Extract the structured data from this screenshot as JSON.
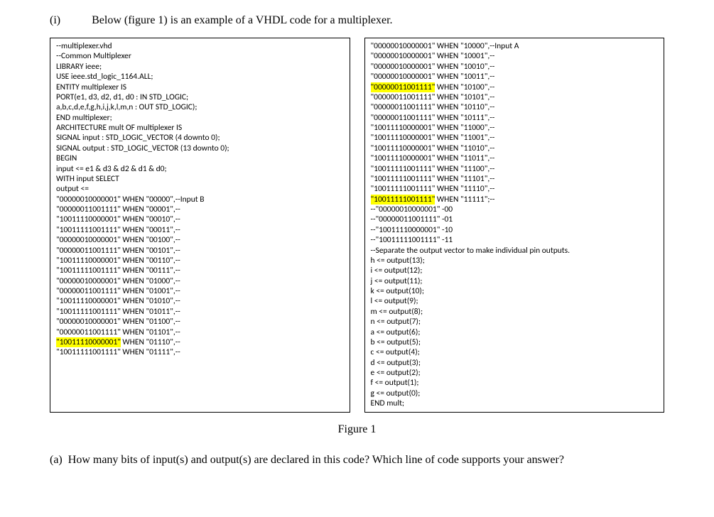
{
  "header": {
    "label": "(i)",
    "text": "Below (figure 1) is an example of a VHDL code for a multiplexer."
  },
  "code_left": {
    "lines": [
      {
        "t": "--multiplexer.vhd",
        "hl": false
      },
      {
        "t": "--Common Multiplexer",
        "hl": false
      },
      {
        "t": "LIBRARY ieee;",
        "hl": false
      },
      {
        "t": "USE ieee.std_logic_1164.ALL;",
        "hl": false
      },
      {
        "t": "ENTITY multiplexer IS",
        "hl": false
      },
      {
        "t": "PORT(e1, d3, d2, d1, d0 : IN STD_LOGIC;",
        "hl": false
      },
      {
        "t": "a,b,c,d,e,f,g,h,i,j,k,l,m,n : OUT STD_LOGIC);",
        "hl": false
      },
      {
        "t": "END multiplexer;",
        "hl": false
      },
      {
        "t": "ARCHITECTURE mult OF multiplexer IS",
        "hl": false
      },
      {
        "t": "SIGNAL input : STD_LOGIC_VECTOR (4 downto 0);",
        "hl": false
      },
      {
        "t": "SIGNAL output : STD_LOGIC_VECTOR (13 downto 0);",
        "hl": false
      },
      {
        "t": "BEGIN",
        "hl": false
      },
      {
        "t": "input <= e1 & d3 & d2 & d1 & d0;",
        "hl": false
      },
      {
        "t": "WITH input SELECT",
        "hl": false
      },
      {
        "t": "output <=",
        "hl": false
      },
      {
        "t": "\"00000010000001\" WHEN \"00000\",--Input B",
        "hl": false
      },
      {
        "t": "\"00000011001111\" WHEN \"00001\",--",
        "hl": false
      },
      {
        "t": "\"10011110000001\" WHEN \"00010\",--",
        "hl": false
      },
      {
        "t": "\"10011111001111\" WHEN \"00011\",--",
        "hl": false
      },
      {
        "t": "\"00000010000001\" WHEN \"00100\",--",
        "hl": false
      },
      {
        "t": "\"00000011001111\" WHEN \"00101\",--",
        "hl": false
      },
      {
        "t": "\"10011110000001\" WHEN \"00110\",--",
        "hl": false
      },
      {
        "t": "\"10011111001111\" WHEN \"00111\",--",
        "hl": false
      },
      {
        "t": "\"00000010000001\" WHEN \"01000\",--",
        "hl": false
      },
      {
        "t": "\"00000011001111\" WHEN \"01001\",--",
        "hl": false
      },
      {
        "t": "\"10011110000001\" WHEN \"01010\",--",
        "hl": false
      },
      {
        "t": "\"10011111001111\" WHEN \"01011\",--",
        "hl": false
      },
      {
        "t": "\"00000010000001\" WHEN \"01100\",--",
        "hl": false
      },
      {
        "t": "\"00000011001111\" WHEN \"01101\",--",
        "hl": false
      },
      {
        "t": "\"10011110000001\"",
        "hl": true,
        "suffix": " WHEN \"01110\",--"
      },
      {
        "t": "\"10011111001111\" WHEN \"01111\",--",
        "hl": false
      }
    ]
  },
  "code_right": {
    "lines": [
      {
        "t": "\"00000010000001\" WHEN \"10000\",--Input A",
        "hl": false
      },
      {
        "t": "\"00000010000001\" WHEN \"10001\",--",
        "hl": false
      },
      {
        "t": "\"00000010000001\" WHEN \"10010\",--",
        "hl": false
      },
      {
        "t": "\"00000010000001\" WHEN \"10011\",--",
        "hl": false
      },
      {
        "t": "\"00000011001111\"",
        "hl": true,
        "suffix": " WHEN \"10100\",--"
      },
      {
        "t": "\"00000011001111\" WHEN \"10101\",--",
        "hl": false
      },
      {
        "t": "\"00000011001111\" WHEN \"10110\",--",
        "hl": false
      },
      {
        "t": "\"00000011001111\" WHEN \"10111\",--",
        "hl": false
      },
      {
        "t": "\"10011110000001\" WHEN \"11000\",--",
        "hl": false
      },
      {
        "t": "\"10011110000001\" WHEN \"11001\",--",
        "hl": false
      },
      {
        "t": "\"10011110000001\" WHEN \"11010\",--",
        "hl": false
      },
      {
        "t": "\"10011110000001\" WHEN \"11011\",--",
        "hl": false
      },
      {
        "t": "\"10011111001111\" WHEN \"11100\",--",
        "hl": false
      },
      {
        "t": "\"10011111001111\" WHEN \"11101\",--",
        "hl": false
      },
      {
        "t": "\"10011111001111\" WHEN \"11110\",--",
        "hl": false
      },
      {
        "t": "\"10011111001111\"",
        "hl": true,
        "suffix": " WHEN \"11111\";--"
      },
      {
        "t": "--\"00000010000001\" -00",
        "hl": false
      },
      {
        "t": "--\"00000011001111\" -01",
        "hl": false
      },
      {
        "t": "--\"10011110000001\" -10",
        "hl": false
      },
      {
        "t": "--\"10011111001111\" -11",
        "hl": false
      },
      {
        "t": "--Separate the output vector to make individual pin outputs.",
        "hl": false
      },
      {
        "t": "h <= output(13);",
        "hl": false
      },
      {
        "t": "i <= output(12);",
        "hl": false
      },
      {
        "t": "j <= output(11);",
        "hl": false
      },
      {
        "t": "k <= output(10);",
        "hl": false
      },
      {
        "t": "l <= output(9);",
        "hl": false
      },
      {
        "t": "m <= output(8);",
        "hl": false
      },
      {
        "t": "n <= output(7);",
        "hl": false
      },
      {
        "t": "a <= output(6);",
        "hl": false
      },
      {
        "t": "b <= output(5);",
        "hl": false
      },
      {
        "t": "c <= output(4);",
        "hl": false
      },
      {
        "t": "d <= output(3);",
        "hl": false
      },
      {
        "t": "e <= output(2);",
        "hl": false
      },
      {
        "t": "f <= output(1);",
        "hl": false
      },
      {
        "t": "g <= output(0);",
        "hl": false
      },
      {
        "t": "END mult;",
        "hl": false
      }
    ]
  },
  "figure_label": "Figure 1",
  "question": {
    "label": "(a)",
    "text": "How many bits of input(s) and output(s) are declared in this code? Which line of code supports your answer?"
  }
}
